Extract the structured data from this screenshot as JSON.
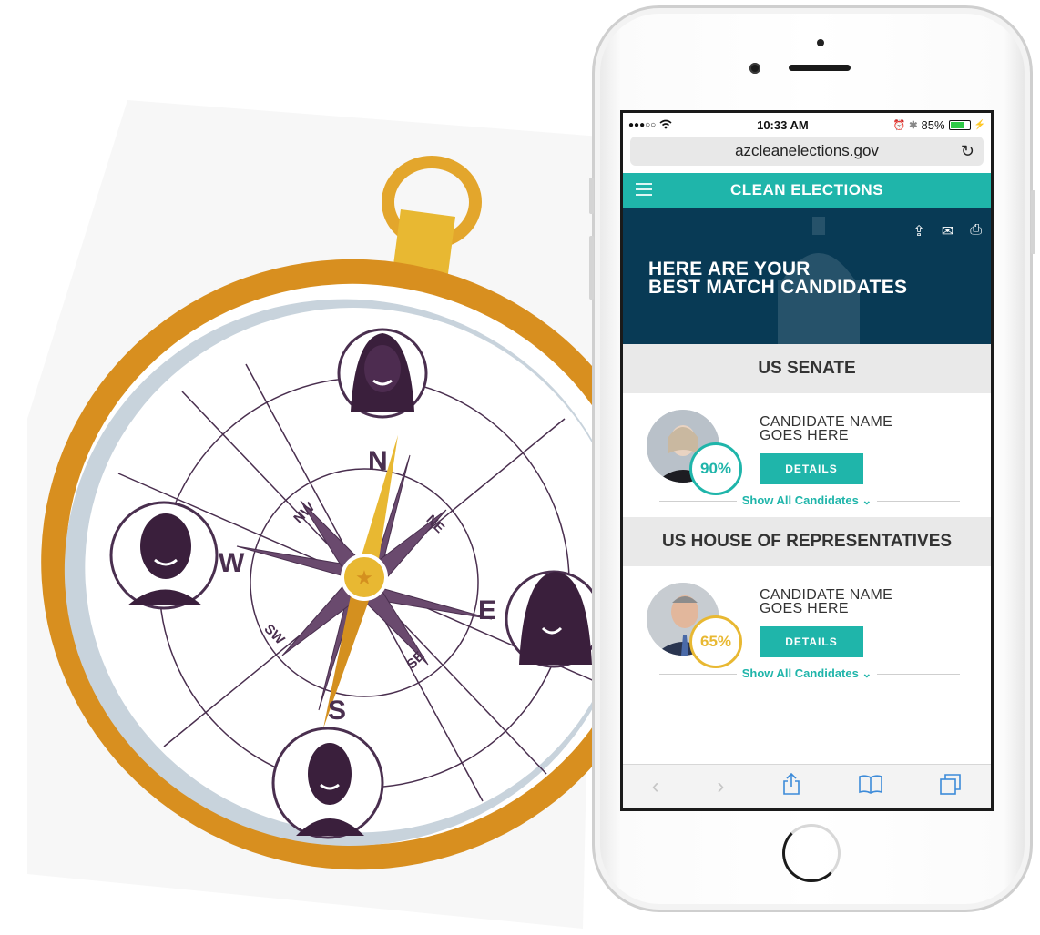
{
  "status_bar": {
    "signal": "●●●○○",
    "wifi_icon": "wifi-icon",
    "time": "10:33 AM",
    "battery": "85%",
    "battery_level": 0.85
  },
  "browser": {
    "url": "azcleanelections.gov",
    "reload_icon": "C"
  },
  "site": {
    "title": "CLEAN ELECTIONS",
    "brand_color": "#1fb5aa",
    "hero_color": "#083a55",
    "hero_line1": "HERE ARE YOUR",
    "hero_line2": "BEST MATCH CANDIDATES"
  },
  "sections": [
    {
      "title": "US SENATE",
      "candidate": {
        "name_line1": "CANDIDATE NAME",
        "name_line2": "GOES HERE",
        "match": "90%",
        "match_color": "#1fb5aa",
        "button": "DETAILS"
      },
      "show_all": "Show All Candidates ⌄"
    },
    {
      "title": "US HOUSE OF REPRESENTATIVES",
      "candidate": {
        "name_line1": "CANDIDATE NAME",
        "name_line2": "GOES HERE",
        "match": "65%",
        "match_color": "#e8b832",
        "button": "DETAILS"
      },
      "show_all": "Show All Candidates ⌄"
    }
  ],
  "toolbar": {
    "back": "‹",
    "forward": "›"
  },
  "compass": {
    "directions": {
      "n": "N",
      "s": "S",
      "e": "E",
      "w": "W",
      "ne": "NE",
      "nw": "NW",
      "se": "SE",
      "sw": "SW"
    },
    "ring_color": "#d4901f",
    "line_color": "#4a2f4f"
  }
}
